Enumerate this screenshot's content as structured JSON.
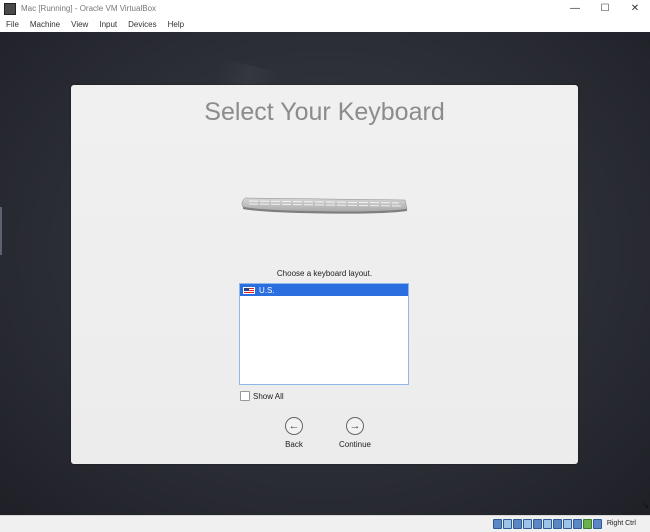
{
  "window": {
    "title": "Mac [Running] - Oracle VM VirtualBox",
    "controls": {
      "minimize": "—",
      "maximize": "☐",
      "close": "✕"
    }
  },
  "menubar": {
    "items": [
      "File",
      "Machine",
      "View",
      "Input",
      "Devices",
      "Help"
    ]
  },
  "installer": {
    "title": "Select Your Keyboard",
    "layout_prompt": "Choose a keyboard layout.",
    "layouts": [
      {
        "label": "U.S.",
        "selected": true,
        "icon": "us-flag-icon"
      }
    ],
    "show_all_label": "Show All",
    "show_all_checked": false,
    "back_label": "Back",
    "continue_label": "Continue",
    "back_icon": "←",
    "continue_icon": "→"
  },
  "statusbar": {
    "host_key": "Right Ctrl"
  },
  "colors": {
    "selection": "#2a6ee0",
    "title_text": "#8c8c8c",
    "vm_background": "#2c2e36"
  }
}
